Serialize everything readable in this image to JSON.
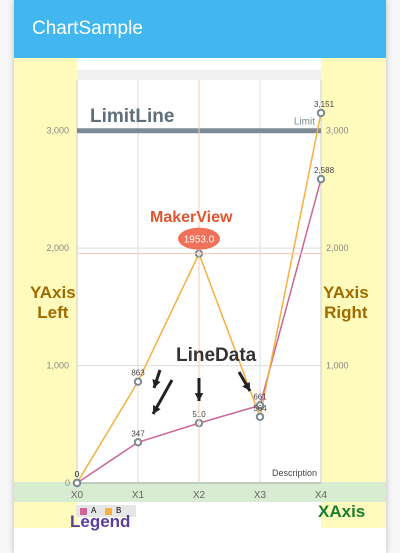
{
  "app": {
    "title": "ChartSample"
  },
  "chart_data": {
    "type": "line",
    "x": [
      "X0",
      "X1",
      "X2",
      "X3",
      "X4"
    ],
    "series": [
      {
        "name": "A",
        "values": [
          0,
          347,
          510,
          661,
          2588
        ],
        "color": "#cc6699"
      },
      {
        "name": "B",
        "values": [
          0,
          863,
          1953,
          564,
          3151
        ],
        "color": "#f5b041"
      }
    ],
    "ylim": [
      0,
      3151
    ],
    "yticks": [
      "1,000",
      "2,000",
      "3,000"
    ],
    "limit_line": {
      "value": 3000,
      "label": "Limit"
    },
    "marker": {
      "x": "X2",
      "value": "1953.0"
    },
    "description": "Description",
    "data_labels_b": [
      "0",
      "863",
      "",
      "564",
      "3,151"
    ],
    "data_labels_a": [
      "0",
      "347",
      "510",
      "661",
      "2,588"
    ]
  },
  "annotations": {
    "limit_line": "LimitLine",
    "marker_view": "MakerView",
    "yaxis_left": [
      "YAxis",
      "Left"
    ],
    "yaxis_right": [
      "YAxis",
      "Right"
    ],
    "line_data": "LineData",
    "legend": "Legend",
    "xaxis": "XAxis"
  },
  "colors": {
    "appbar": "#42b6ee",
    "axis_band": "#fffbbd",
    "xaxis_band": "#d7ecd0",
    "limit": "#7d8b95",
    "marker": "#f0715a"
  }
}
